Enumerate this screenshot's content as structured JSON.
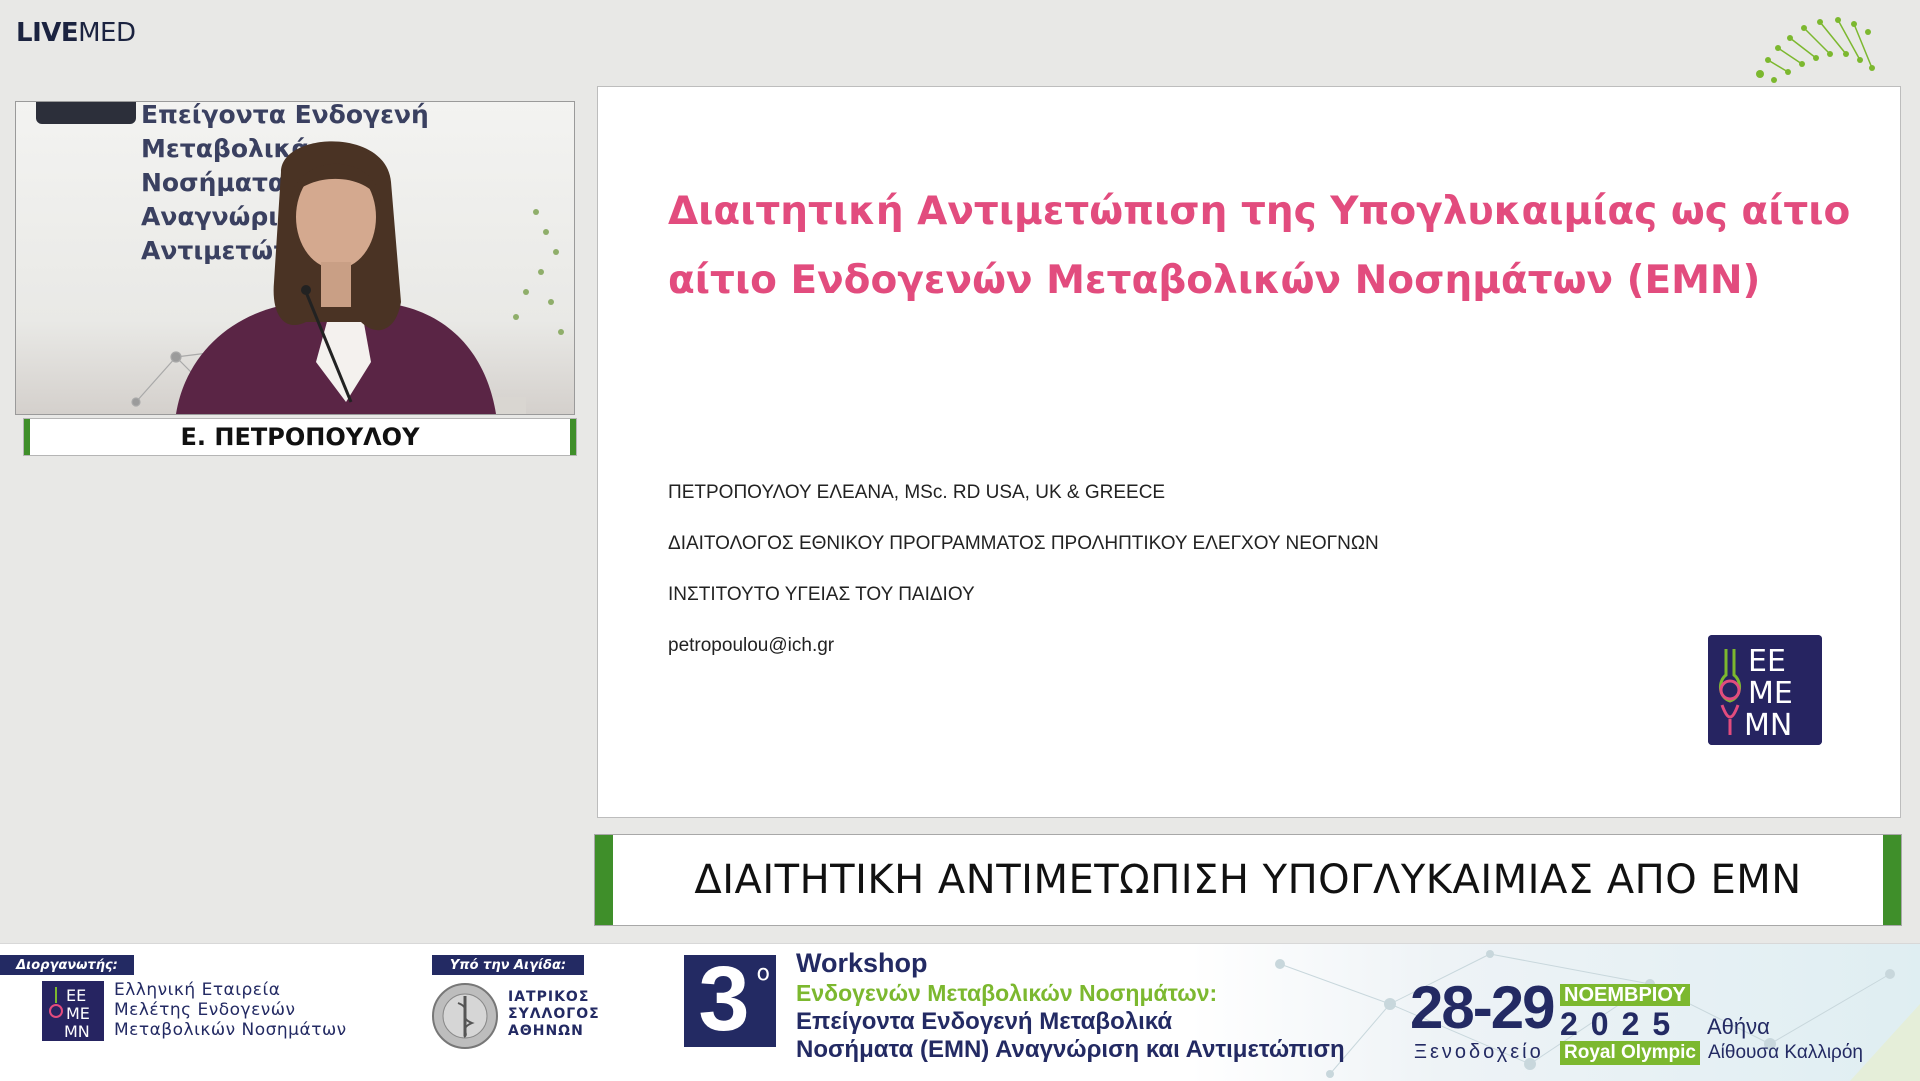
{
  "brand": {
    "bold": "LIVE",
    "regular": "MED"
  },
  "video": {
    "background_text": "Επείγοντα Ενδογενή Μεταβολικά\nΝοσήματα (EMN)\nΑναγνώριση και Αντιμετώπιση",
    "speaker_name": "Ε. ΠΕΤΡΟΠΟΥΛΟΥ"
  },
  "slide": {
    "title_line1": "Διαιτητική Αντιμετώπιση της Υπογλυκαιμίας ως αίτιο",
    "title_line2": "αίτιο Ενδογενών Μεταβολικών Νοσημάτων (ΕΜΝ)",
    "info": [
      "ΠΕΤΡΟΠΟΥΛΟΥ ΕΛΕΑΝΑ, MSc. RD USA, UK & GREECE",
      "ΔΙΑΙΤΟΛΟΓΟΣ ΕΘΝΙΚΟΥ ΠΡΟΓΡΑΜΜΑΤΟΣ ΠΡΟΛΗΠΤΙΚΟΥ ΕΛΕΓΧΟΥ ΝΕΟΓΝΩΝ",
      "ΙΝΣΤΙΤΟΥΤΟ ΥΓΕΙΑΣ ΤΟΥ ΠΑΙΔΙΟΥ",
      "petropoulou@ich.gr"
    ],
    "logo_lines": [
      "EE",
      "ME",
      "MN"
    ]
  },
  "caption": "ΔΙΑΙΤΗΤΙΚΗ ΑΝΤΙΜΕΤΩΠΙΣΗ ΥΠΟΓΛΥΚΑΙΜΙΑΣ ΑΠΟ ΕΜΝ",
  "footer": {
    "organizer_label": "Διοργανωτής:",
    "organizer_lines": [
      "Ελληνική Εταιρεία",
      "Μελέτης  Ενδογενών",
      "Μεταβολικών Νοσημάτων"
    ],
    "aegis_label": "Υπό την Αιγίδα:",
    "aegis_lines": [
      "ΙΑΤΡΙΚΟΣ",
      "ΣΥΛΛΟΓΟΣ",
      "ΑΘΗΝΩΝ"
    ],
    "workshop_number": "3",
    "workshop_sup": "ο",
    "workshop_title": "Workshop",
    "workshop_subtitle": "Ενδογενών Μεταβολικών Νοσημάτων:",
    "workshop_line3": "Επείγοντα Ενδογενή Μεταβολικά",
    "workshop_line4": "Νοσήματα (ΕΜΝ) Αναγνώριση και Αντιμετώπιση",
    "dates": "28-29",
    "month": "ΝΟΕΜΒΡΙΟΥ",
    "year": "2025",
    "city": "Αθήνα",
    "hotel_prefix": "Ξενοδοχείο",
    "hotel_name": "Royal Olympic",
    "hall": "Αίθουσα Καλλιρόη"
  },
  "colors": {
    "accent_green": "#3f8f2a",
    "title_pink": "#e24c7e",
    "navy": "#232a63",
    "lime": "#7cb82f"
  }
}
